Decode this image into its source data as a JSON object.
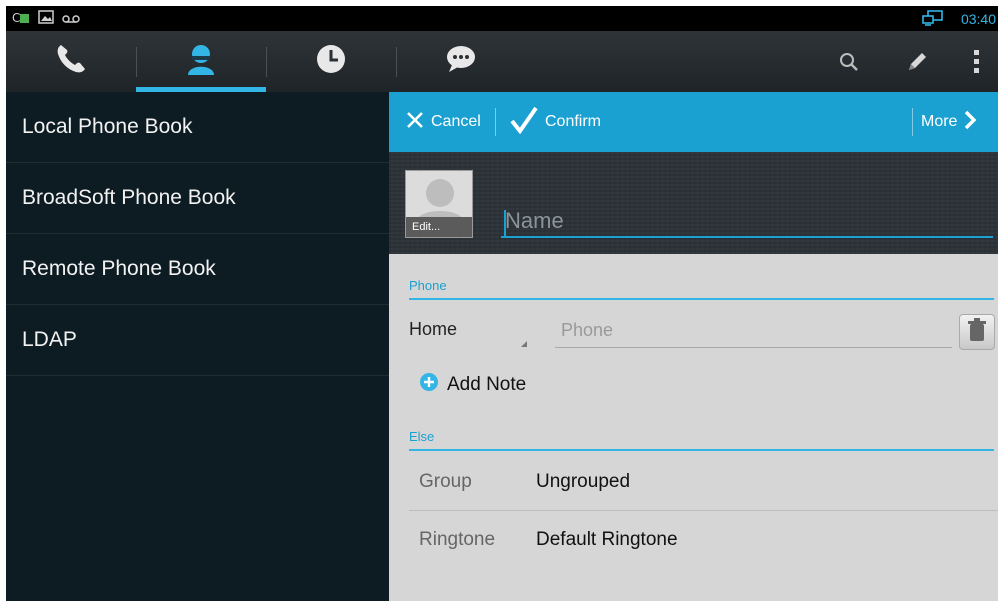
{
  "statusbar": {
    "time": "03:40"
  },
  "tabs": [
    {
      "icon": "phone-icon",
      "active": false
    },
    {
      "icon": "contacts-icon",
      "active": true
    },
    {
      "icon": "clock-icon",
      "active": false
    },
    {
      "icon": "message-icon",
      "active": false
    }
  ],
  "actionbar": {
    "icons": [
      "search-icon",
      "edit-pencil-icon",
      "overflow-menu-icon"
    ]
  },
  "phonebooks": [
    {
      "label": "Local Phone Book"
    },
    {
      "label": "BroadSoft Phone Book"
    },
    {
      "label": "Remote Phone Book"
    },
    {
      "label": "LDAP"
    }
  ],
  "editor": {
    "cancel_label": "Cancel",
    "confirm_label": "Confirm",
    "more_label": "More",
    "avatar_edit_label": "Edit...",
    "name_placeholder": "Name",
    "phone_section": "Phone",
    "phone_type": "Home",
    "phone_placeholder": "Phone",
    "add_note_label": "Add Note",
    "else_section": "Else",
    "group_key": "Group",
    "group_value": "Ungrouped",
    "ringtone_key": "Ringtone",
    "ringtone_value": "Default Ringtone"
  },
  "colors": {
    "accent": "#33b5e5",
    "bar": "#1ba1d1",
    "panel": "#0d1b22",
    "form": "#d6d6d6"
  }
}
